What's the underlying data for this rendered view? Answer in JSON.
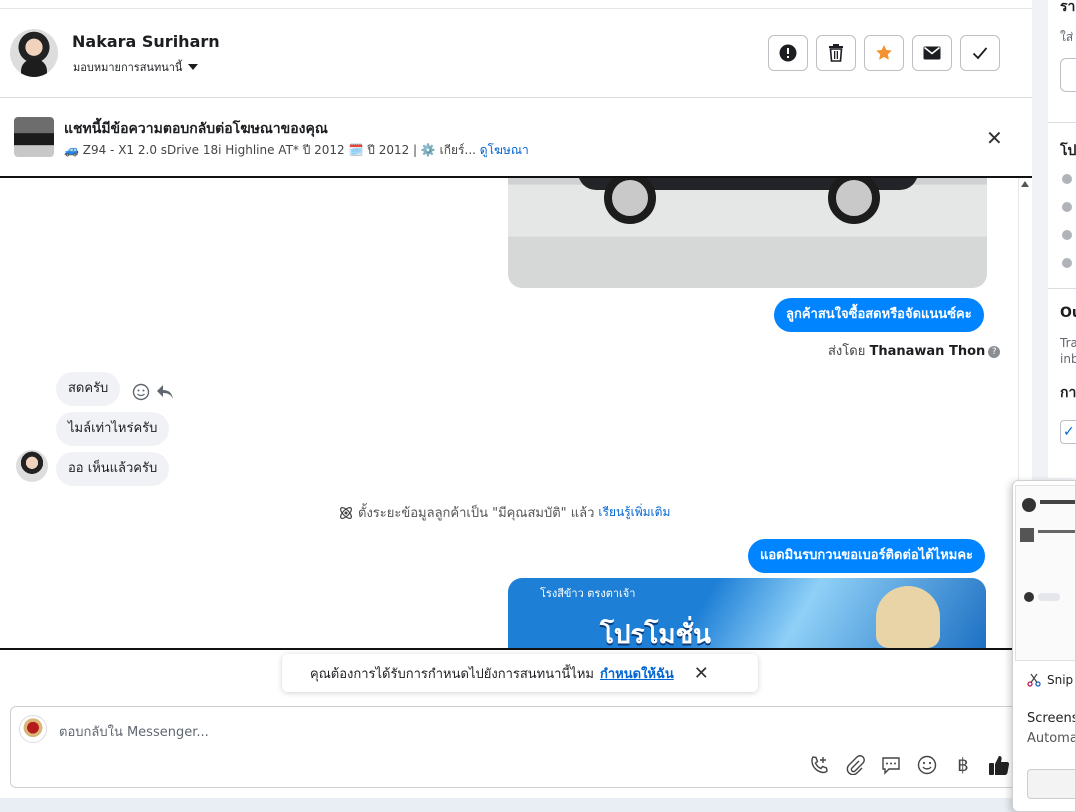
{
  "header": {
    "contact_name": "Nakara Suriharn",
    "assign_label": "มอบหมายการสนทนานี้"
  },
  "ad_banner": {
    "title": "แชทนี้มีข้อความตอบกลับต่อโฆษณาของคุณ",
    "subtitle": "🚙 Z94 - X1 2.0 sDrive 18i Highline AT* ปี 2012 🗓️ ปี 2012 | ⚙️ เกียร์...",
    "link": "ดูโฆษณา"
  },
  "messages": {
    "out_1": "ลูกค้าสนใจซื้อสดหรือจัดแนนซ์คะ",
    "sent_by_prefix": "ส่งโดย",
    "sent_by_name": "Thanawan Thon",
    "in_1": "สดครับ",
    "in_2": "ไมล์เท่าไหร่ครับ",
    "in_3": "ออ เห็นแล้วครับ",
    "system_note": "ตั้งระยะข้อมูลลูกค้าเป็น \"มีคุณสมบัติ\" แล้ว",
    "system_link": "เรียนรู้เพิ่มเติม",
    "out_2": "แอดมินรบกวนขอเบอร์ติดต่อได้ไหมคะ",
    "promo_top": "โรงสีข้าว ตรงตาเจ้า",
    "promo_text": "โปรโมชั่น"
  },
  "suggestion": {
    "text": "คุณต้องการได้รับการกำหนดไปยังการสนทนานี้ไหม",
    "link": "กำหนดให้ฉัน"
  },
  "composer": {
    "placeholder": "ตอบกลับใน Messenger..."
  },
  "right_panel": {
    "heading_1": "รา",
    "sub_1": "ใส่",
    "heading_2": "โป",
    "heading_3": "Ou",
    "sub_3a": "Tra",
    "sub_3b": "inb",
    "heading_4": "กา"
  },
  "snip": {
    "app": "Snip",
    "title": "Screensh",
    "subtitle": "Automa"
  },
  "colors": {
    "accent": "#0084ff",
    "link": "#0064d1",
    "star": "#f5922f"
  }
}
